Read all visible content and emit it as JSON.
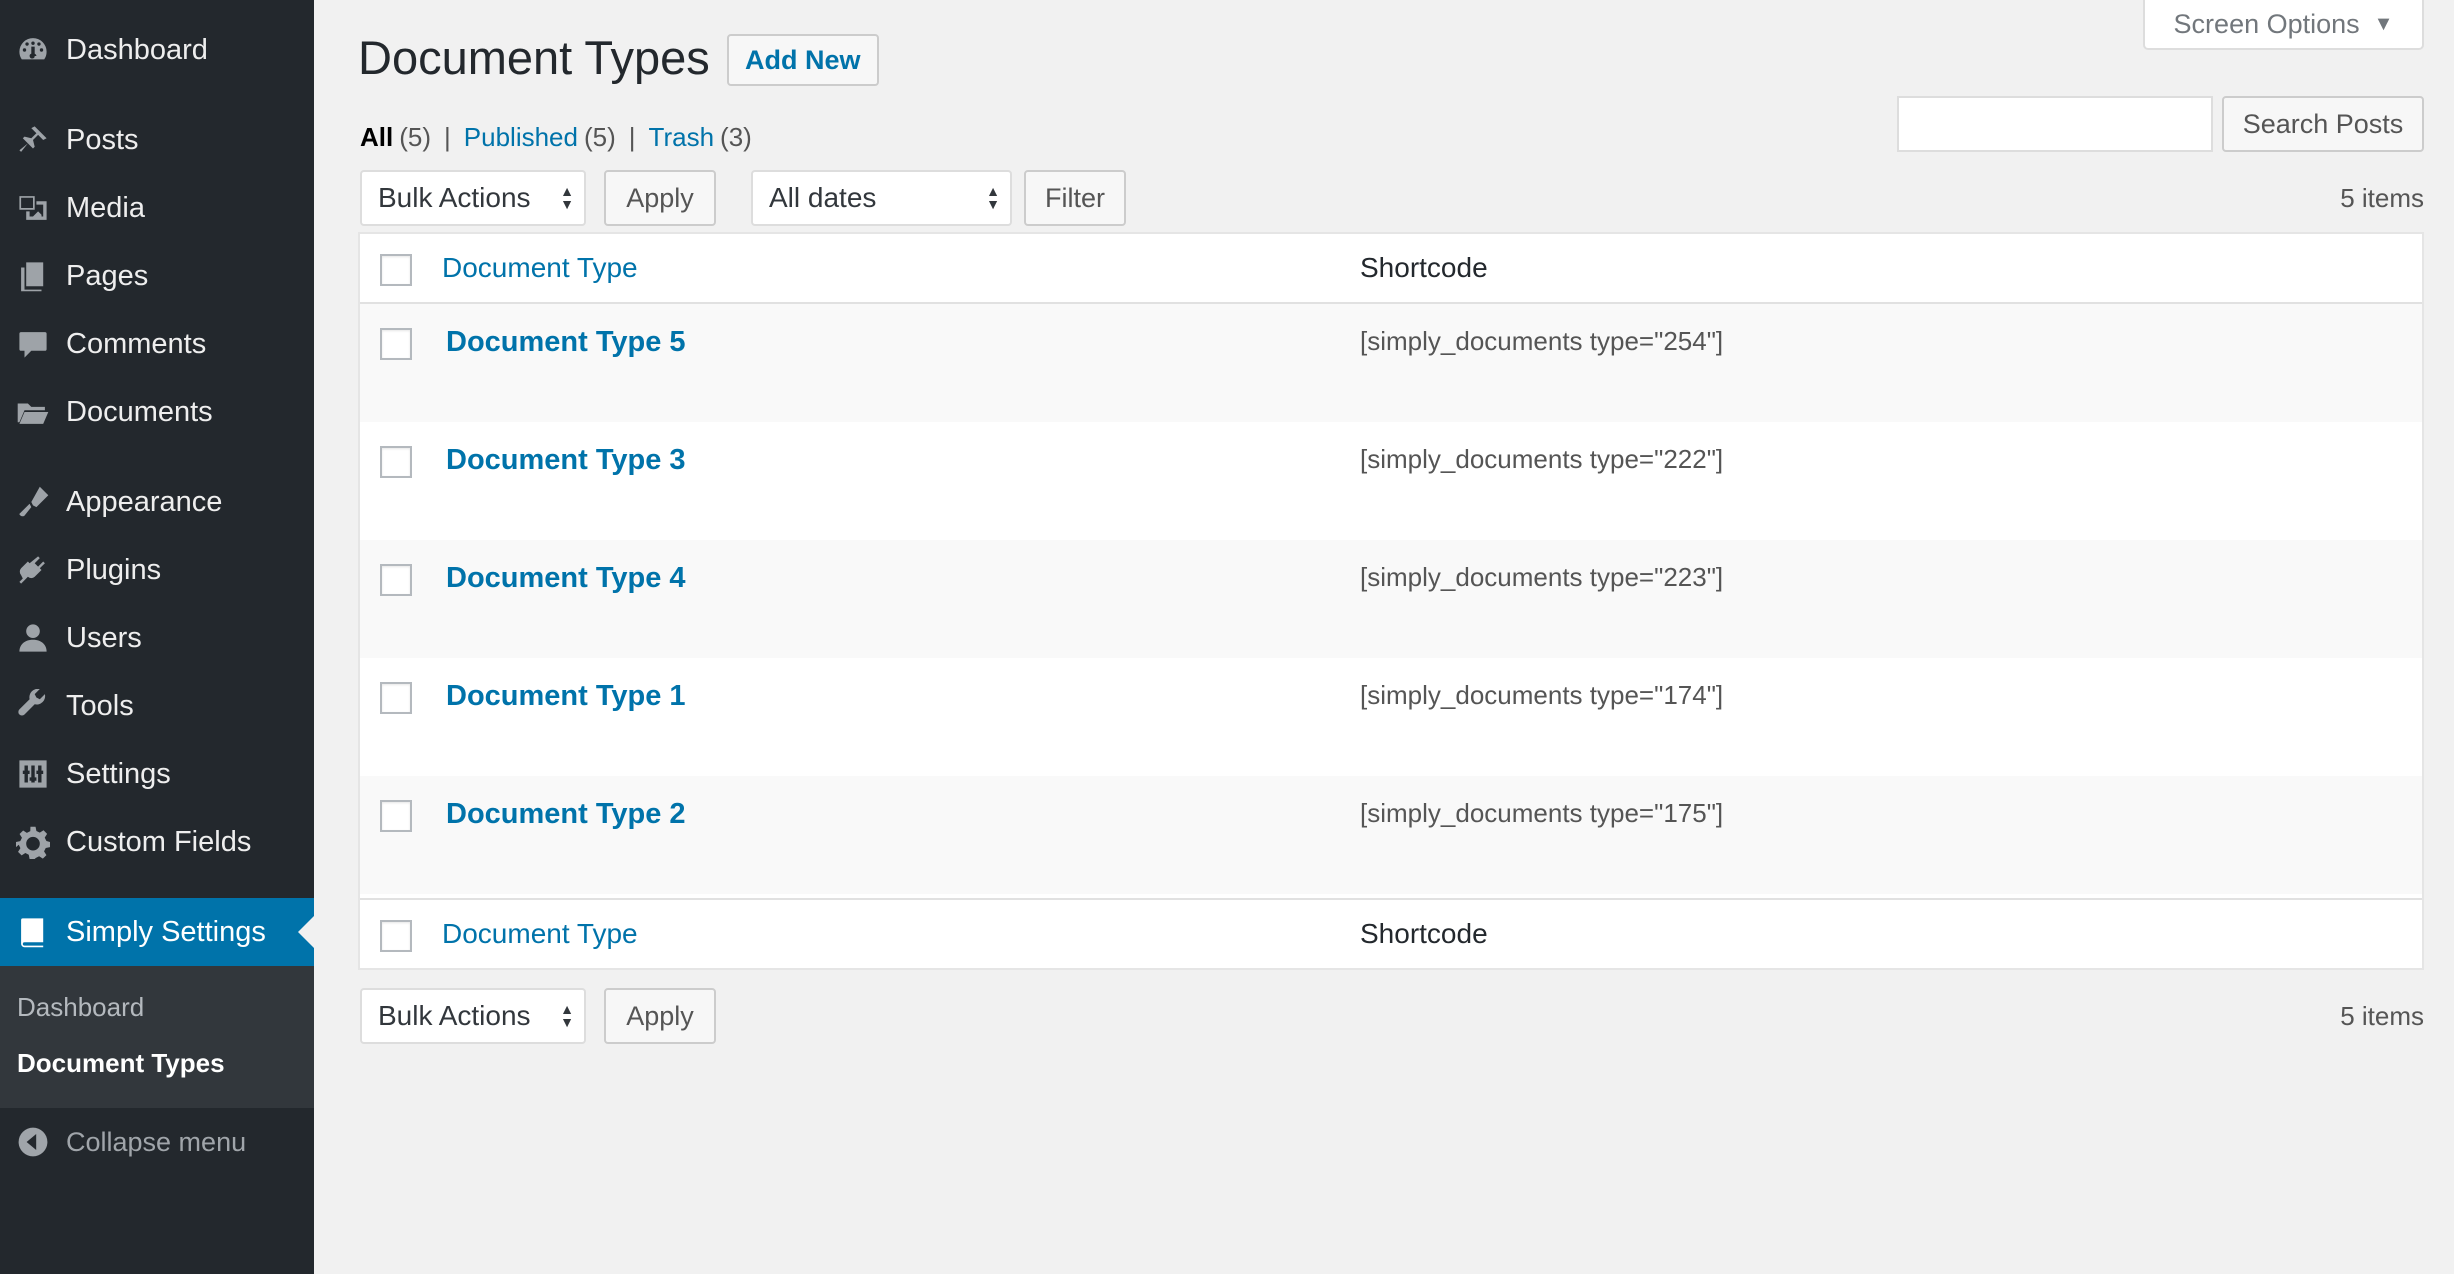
{
  "sidebar": {
    "items": [
      {
        "label": "Dashboard",
        "icon": "dashboard-icon"
      },
      {
        "label": "Posts",
        "icon": "pin-icon"
      },
      {
        "label": "Media",
        "icon": "media-icon"
      },
      {
        "label": "Pages",
        "icon": "pages-icon"
      },
      {
        "label": "Comments",
        "icon": "comment-icon"
      },
      {
        "label": "Documents",
        "icon": "folder-icon"
      },
      {
        "label": "Appearance",
        "icon": "brush-icon"
      },
      {
        "label": "Plugins",
        "icon": "plug-icon"
      },
      {
        "label": "Users",
        "icon": "user-icon"
      },
      {
        "label": "Tools",
        "icon": "wrench-icon"
      },
      {
        "label": "Settings",
        "icon": "settings-icon"
      },
      {
        "label": "Custom Fields",
        "icon": "gear-icon"
      },
      {
        "label": "Simply Settings",
        "icon": "book-icon"
      }
    ],
    "submenu": [
      {
        "label": "Dashboard"
      },
      {
        "label": "Document Types"
      }
    ],
    "collapse_label": "Collapse menu",
    "accent_color": "#0073aa"
  },
  "header": {
    "title": "Document Types",
    "add_new": "Add New",
    "screen_options": "Screen Options"
  },
  "filters": {
    "all_label": "All",
    "all_count": "(5)",
    "published_label": "Published",
    "published_count": "(5)",
    "trash_label": "Trash",
    "trash_count": "(3)",
    "sep": "|"
  },
  "search": {
    "value": "",
    "button": "Search Posts"
  },
  "top_nav": {
    "bulk_actions": "Bulk Actions",
    "apply": "Apply",
    "dates": "All dates",
    "filter": "Filter",
    "items": "5 items"
  },
  "table": {
    "col_title": "Document Type",
    "col_shortcode": "Shortcode",
    "rows": [
      {
        "title": "Document Type 5",
        "shortcode": "[simply_documents type=\"254\"]"
      },
      {
        "title": "Document Type 3",
        "shortcode": "[simply_documents type=\"222\"]"
      },
      {
        "title": "Document Type 4",
        "shortcode": "[simply_documents type=\"223\"]"
      },
      {
        "title": "Document Type 1",
        "shortcode": "[simply_documents type=\"174\"]"
      },
      {
        "title": "Document Type 2",
        "shortcode": "[simply_documents type=\"175\"]"
      }
    ]
  },
  "bottom_nav": {
    "bulk_actions": "Bulk Actions",
    "apply": "Apply",
    "items": "5 items"
  }
}
